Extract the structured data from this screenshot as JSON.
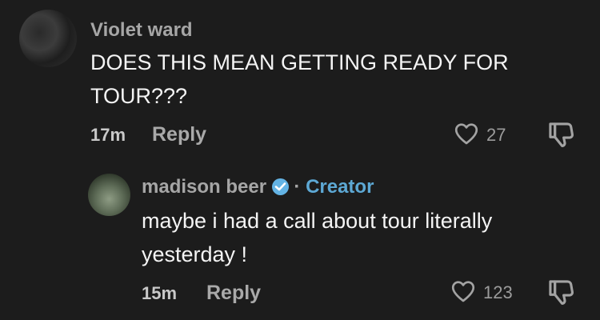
{
  "comments": [
    {
      "username": "Violet ward",
      "text_line1": "DOES THIS MEAN GETTING READY FOR",
      "text_line2": "TOUR???",
      "time": "17m",
      "reply_label": "Reply",
      "likes": "27",
      "like_icon": "heart-outline-icon",
      "dislike_icon": "thumbs-down-icon"
    },
    {
      "username": "madison beer",
      "verified_icon": "verified-check-icon",
      "separator": "·",
      "creator_label": "Creator",
      "text_line1": "maybe i had a call about tour literally",
      "text_line2": "yesterday !",
      "time": "15m",
      "reply_label": "Reply",
      "likes": "123",
      "like_icon": "heart-outline-icon",
      "dislike_icon": "thumbs-down-icon"
    }
  ],
  "colors": {
    "background": "#1c1c1c",
    "creator_accent": "#5da8d4",
    "verified_badge": "#63b3e4"
  }
}
